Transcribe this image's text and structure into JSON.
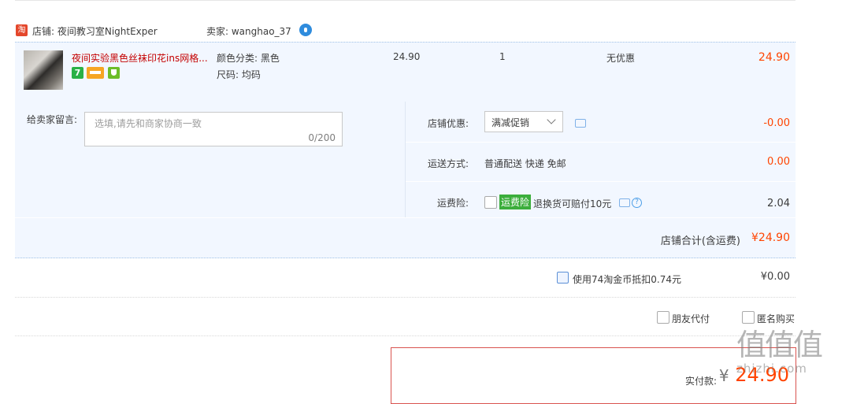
{
  "shop": {
    "icon_text": "淘",
    "name_label": "店铺: 夜间教习室NightExper",
    "seller_label": "卖家: wanghao_37",
    "wangwang_icon": "wangwang-chat-icon"
  },
  "item": {
    "title": "夜间实验黑色丝袜印花ins网格...",
    "badge_7": "7",
    "sku_color": "颜色分类: 黑色",
    "sku_size": "尺码: 均码",
    "price": "24.90",
    "quantity": "1",
    "discount": "无优惠",
    "subtotal": "24.90"
  },
  "message": {
    "label": "给卖家留言:",
    "placeholder": "选填,请先和商家协商一致",
    "count": "0/200"
  },
  "options": {
    "promo_label": "店铺优惠:",
    "promo_selected": "满减促销",
    "promo_value": "-0.00",
    "ship_label": "运送方式:",
    "ship_text": "普通配送 快递 免邮",
    "ship_value": "0.00",
    "insurance_label": "运费险:",
    "insurance_tag": "运费险",
    "insurance_desc": "退换货可赔付10元",
    "insurance_value": "2.04"
  },
  "shop_total": {
    "label": "店铺合计(含运费)",
    "value": "¥24.90"
  },
  "coin": {
    "label": "使用74淘金币抵扣0.74元",
    "value": "¥0.00"
  },
  "extras": {
    "friend_pay": "朋友代付",
    "anonymous": "匿名购买"
  },
  "payment": {
    "label": "实付款:",
    "currency": "¥",
    "amount": "24.90"
  },
  "watermark": {
    "big": "值值值",
    "small": "zhizhi.com"
  },
  "colors": {
    "accent_orange": "#ff4400",
    "title_red": "#c40000",
    "row_bg": "#f2f7ff"
  }
}
